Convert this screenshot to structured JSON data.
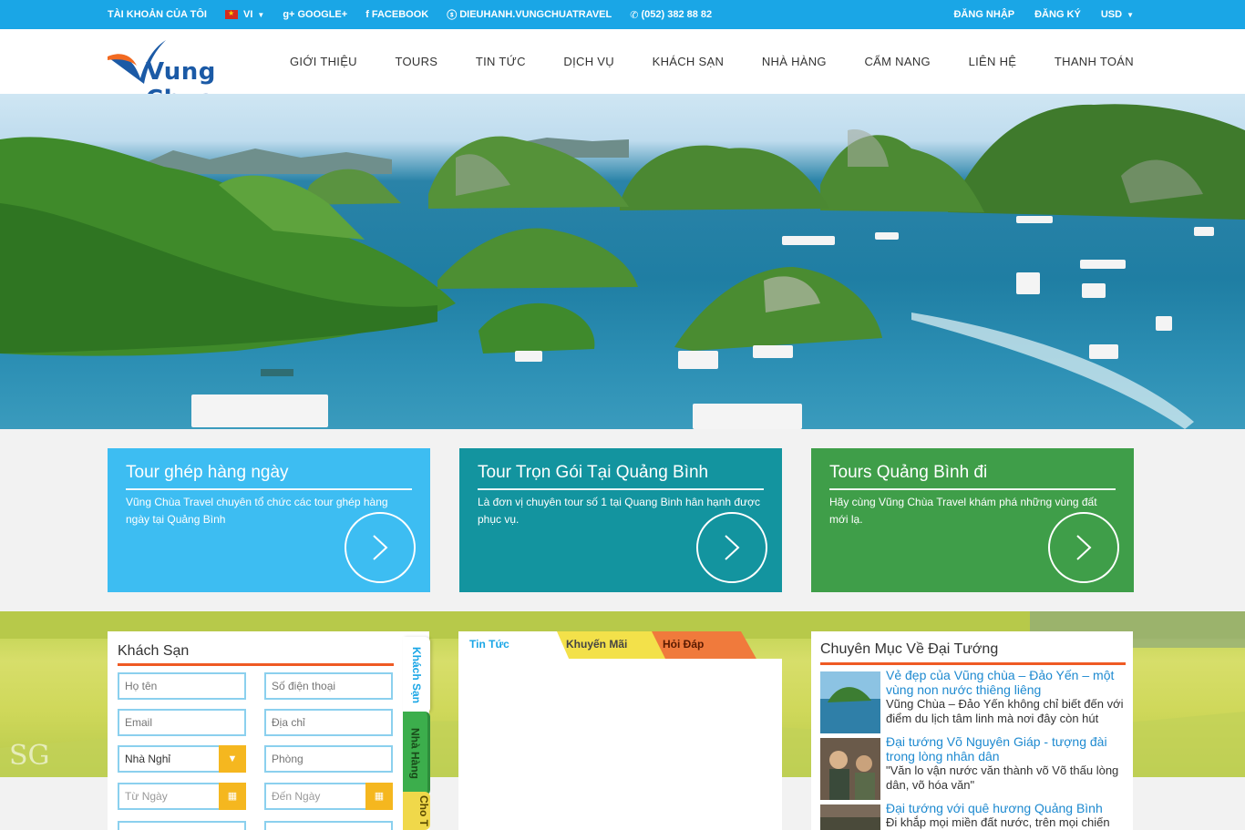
{
  "topbar": {
    "account": "TÀI KHOẢN CỦA TÔI",
    "language": "VI",
    "google": "GOOGLE+",
    "facebook": "FACEBOOK",
    "skype": "DIEUHANH.VUNGCHUATRAVEL",
    "phone": "(052) 382 88 82",
    "login": "ĐĂNG NHẬP",
    "register": "ĐĂNG KÝ",
    "currency": "USD"
  },
  "header": {
    "logo_text": "Vung Chua",
    "nav": [
      "GIỚI THIỆU",
      "TOURS",
      "TIN TỨC",
      "DỊCH VỤ",
      "KHÁCH SẠN",
      "NHÀ HÀNG",
      "CẨM NANG",
      "LIÊN HỆ",
      "THANH TOÁN"
    ]
  },
  "promos": [
    {
      "title": "Tour ghép hàng ngày",
      "text": "Vũng Chùa Travel chuyên tổ chức các tour ghép hàng ngày tại Quảng Bình",
      "color": "#3dbdf2"
    },
    {
      "title": "Tour Trọn Gói Tại Quảng Bình",
      "text": "Là đơn vị chuyên tour số 1 tại Quang Binh hân hạnh được phục vụ.",
      "color": "#13949f"
    },
    {
      "title": "Tours Quảng Bình đi",
      "text": "Hãy cùng Vũng Chùa Travel khám phá những vùng đất mới lạ.",
      "color": "#3f9e49"
    }
  ],
  "booking": {
    "title": "Khách Sạn",
    "name_placeholder": "Họ tên",
    "phone_placeholder": "Số điện thoại",
    "email_placeholder": "Email",
    "address_placeholder": "Địa chỉ",
    "type_value": "Nhà Nghỉ",
    "room_placeholder": "Phòng",
    "from_placeholder": "Từ Ngày",
    "to_placeholder": "Đến Ngày",
    "side_tabs": [
      "Khách Sạn",
      "Nhà Hàng",
      "Cho T"
    ]
  },
  "news": {
    "tabs": [
      "Tin Tức",
      "Khuyến Mãi",
      "Hỏi Đáp"
    ]
  },
  "articles": {
    "title": "Chuyên Mục Về Đại Tướng",
    "items": [
      {
        "title": "Vẻ đẹp của Vũng chùa – Đảo Yến – một vùng non nước thiêng liêng",
        "desc": "Vũng Chùa – Đảo Yến không chỉ biết đến với điểm du lịch tâm linh mà nơi đây còn hút"
      },
      {
        "title": "Đại tướng Võ Nguyên Giáp - tượng đài trong lòng nhân dân",
        "desc": "\"Văn lo vận nước văn thành võ Võ thấu lòng dân, võ hóa văn\""
      },
      {
        "title": "Đại tướng với quê hương Quảng Bình",
        "desc": "Đi khắp mọi miền đất nước, trên mọi chiến"
      }
    ]
  }
}
